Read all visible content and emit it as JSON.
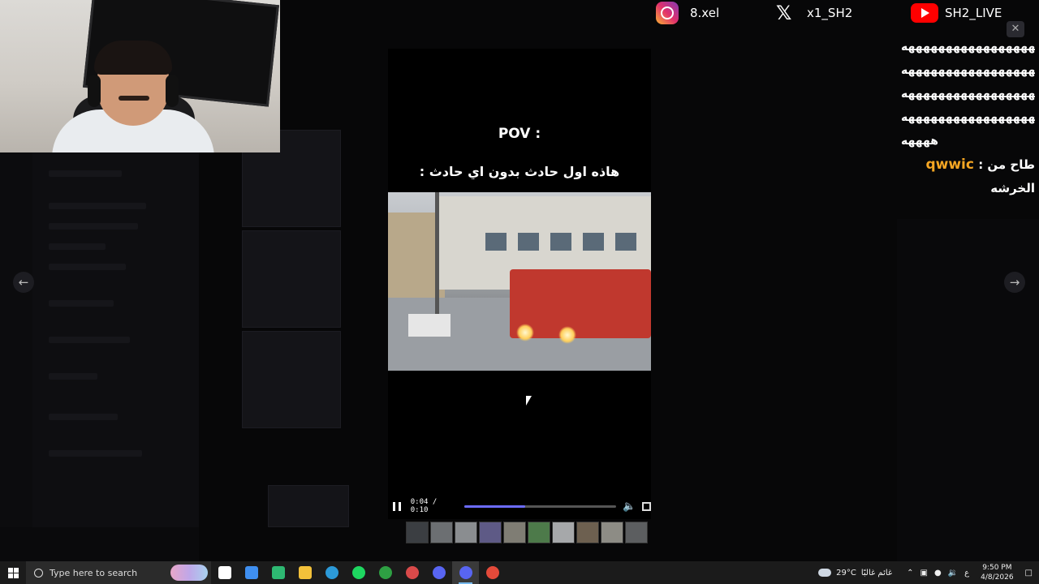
{
  "socials": {
    "instagram": "8.xel",
    "x": "x1_SH2",
    "youtube": "SH2_LIVE"
  },
  "chat": {
    "spam_lines": [
      "ههههههههههههههههههههه",
      "ههههههههههههههههههههه",
      "ههههههههههههههههههههه",
      "ههههههههههههههههههههه",
      "ههههه"
    ],
    "message_prefix": "طاح من :",
    "username": "qwwic",
    "message_text": "الخرشه"
  },
  "video": {
    "title": "POV :",
    "caption": "هاذه اول حادث بدون اي حادث :",
    "time": "0:04 / 0:10",
    "progress": 0.4,
    "accent_color": "#6b6bff"
  },
  "thumbnails": [
    "#3b3e42",
    "#6c6f72",
    "#8a8d90",
    "#5e5a86",
    "#7f7d74",
    "#4d7a4a",
    "#a6a8aa",
    "#6d6050",
    "#8d8c85",
    "#5c5e60"
  ],
  "nav": {
    "prev_icon": "arrow-left-icon",
    "next_icon": "arrow-right-icon"
  },
  "taskbar": {
    "search_placeholder": "Type here to search",
    "apps": [
      {
        "name": "task-view",
        "color": "#ffffff"
      },
      {
        "name": "copilot",
        "color": "#3f8ff0"
      },
      {
        "name": "play-store",
        "color": "#2eb872"
      },
      {
        "name": "file-explorer",
        "color": "#f3c13a"
      },
      {
        "name": "edge",
        "color": "#2c9ad8"
      },
      {
        "name": "spotify",
        "color": "#1ed760"
      },
      {
        "name": "xbox",
        "color": "#2ea043"
      },
      {
        "name": "capture",
        "color": "#d94a4a"
      },
      {
        "name": "discord",
        "color": "#5865f2"
      },
      {
        "name": "discord-active",
        "color": "#5865f2"
      },
      {
        "name": "chrome",
        "color": "#e44a3a"
      }
    ],
    "weather_temp": "29°C",
    "weather_text": "غائم غالبًا",
    "lang": "ع",
    "time": "9:50 PM",
    "date": "4/8/2026"
  }
}
